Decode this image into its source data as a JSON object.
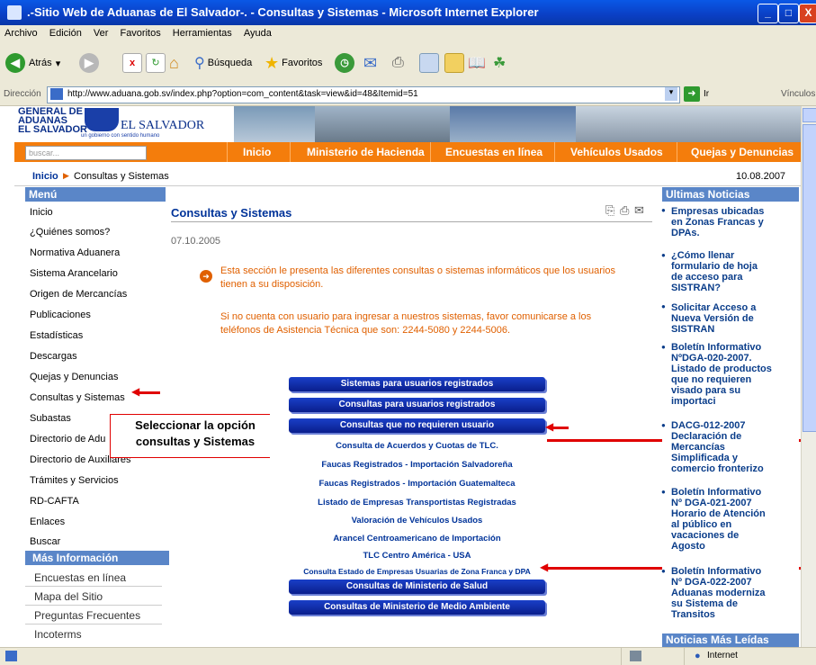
{
  "window": {
    "title": ".-Sitio Web de Aduanas de El Salvador-. - Consultas y Sistemas - Microsoft Internet Explorer",
    "min": "_",
    "max": "□",
    "close": "X"
  },
  "menubar": [
    "Archivo",
    "Edición",
    "Ver",
    "Favoritos",
    "Herramientas",
    "Ayuda"
  ],
  "toolbar": {
    "back": "Atrás",
    "search": "Búsqueda",
    "favorites": "Favoritos"
  },
  "address": {
    "label": "Dirección",
    "url": "http://www.aduana.gob.sv/index.php?option=com_content&task=view&id=48&Itemid=51",
    "go": "Ir",
    "links": "Vínculos"
  },
  "site": {
    "logo_line1": "GENERAL DE",
    "logo_line2": "ADUANAS",
    "logo_line3": "EL SALVADOR",
    "logo_country": "EL SALVADOR",
    "logo_tagline": "un gobierno con sentido humano",
    "search_placeholder": "buscar...",
    "nav": [
      "Inicio",
      "Ministerio de Hacienda",
      "Encuestas en línea",
      "Vehículos Usados",
      "Quejas y Denuncias"
    ]
  },
  "breadcrumb": {
    "home": "Inicio",
    "current": "Consultas y Sistemas",
    "date": "10.08.2007"
  },
  "sidebar": {
    "menu_title": "Menú",
    "items": [
      "Inicio",
      "¿Quiénes somos?",
      "Normativa Aduanera",
      "Sistema Arancelario",
      "Origen de Mercancías",
      "Publicaciones",
      "Estadísticas",
      "Descargas",
      "Quejas y Denuncias",
      "Consultas y Sistemas",
      "Subastas",
      "Directorio de Adu",
      "Directorio de Auxiliares",
      "Trámites y Servicios",
      "RD-CAFTA",
      "Enlaces",
      "Buscar"
    ],
    "more_title": "Más Información",
    "more_items": [
      "Encuestas en línea",
      "Mapa del Sitio",
      "Preguntas Frecuentes",
      "Incoterms"
    ]
  },
  "article": {
    "title": "Consultas y Sistemas",
    "date": "07.10.2005",
    "para1": "Esta sección le presenta las diferentes consultas o sistemas informáticos que los usuarios tienen a su disposición.",
    "para2": "Si no cuenta con usuario para ingresar a nuestros sistemas, favor comunicarse a los teléfonos de Asistencia Técnica que son: 2244-5080 y 2244-5006."
  },
  "panel": {
    "buttons": [
      "Sistemas para usuarios registrados",
      "Consultas para usuarios registrados",
      "Consultas que no requieren usuario"
    ],
    "links": [
      "Consulta de Acuerdos y Cuotas de TLC.",
      "Faucas Registrados - Importación Salvadoreña",
      "Faucas Registrados - Importación Guatemalteca",
      "Listado de Empresas Transportistas Registradas",
      "Valoración de Vehículos Usados",
      "Arancel Centroamericano de Importación",
      "TLC Centro América - USA",
      "Consulta Estado de Empresas Usuarias de Zona Franca y DPA"
    ],
    "bottom_buttons": [
      "Consultas de Ministerio de Salud",
      "Consultas de Ministerio de Medio Ambiente"
    ]
  },
  "callout": {
    "line1": "Seleccionar la opción",
    "line2": "consultas y Sistemas"
  },
  "news": {
    "title": "Ultimas Noticias",
    "lines": [
      "Empresas ubicadas",
      "en Zonas Francas y",
      "DPAs.",
      "¿Cómo llenar",
      "formulario de hoja",
      "de acceso para",
      "SISTRAN?",
      "Solicitar Acceso a",
      "Nueva Versión de",
      "SISTRAN",
      "Boletín Informativo",
      "NºDGA-020-2007.",
      "Listado de productos",
      "que no requieren",
      "visado para su",
      "importaci",
      "DACG-012-2007",
      "Declaración de",
      "Mercancías",
      "Simplificada y",
      "comercio fronterizo",
      "Boletín Informativo",
      "Nº DGA-021-2007",
      "Horario de Atención",
      "al público en",
      "vacaciones de",
      "Agosto",
      "Boletín Informativo",
      "Nº DGA-022-2007",
      "Aduanas moderniza",
      "su Sistema de",
      "Transitos"
    ],
    "next_title": "Noticias Más Leídas"
  },
  "statusbar": {
    "zone": "Internet"
  }
}
